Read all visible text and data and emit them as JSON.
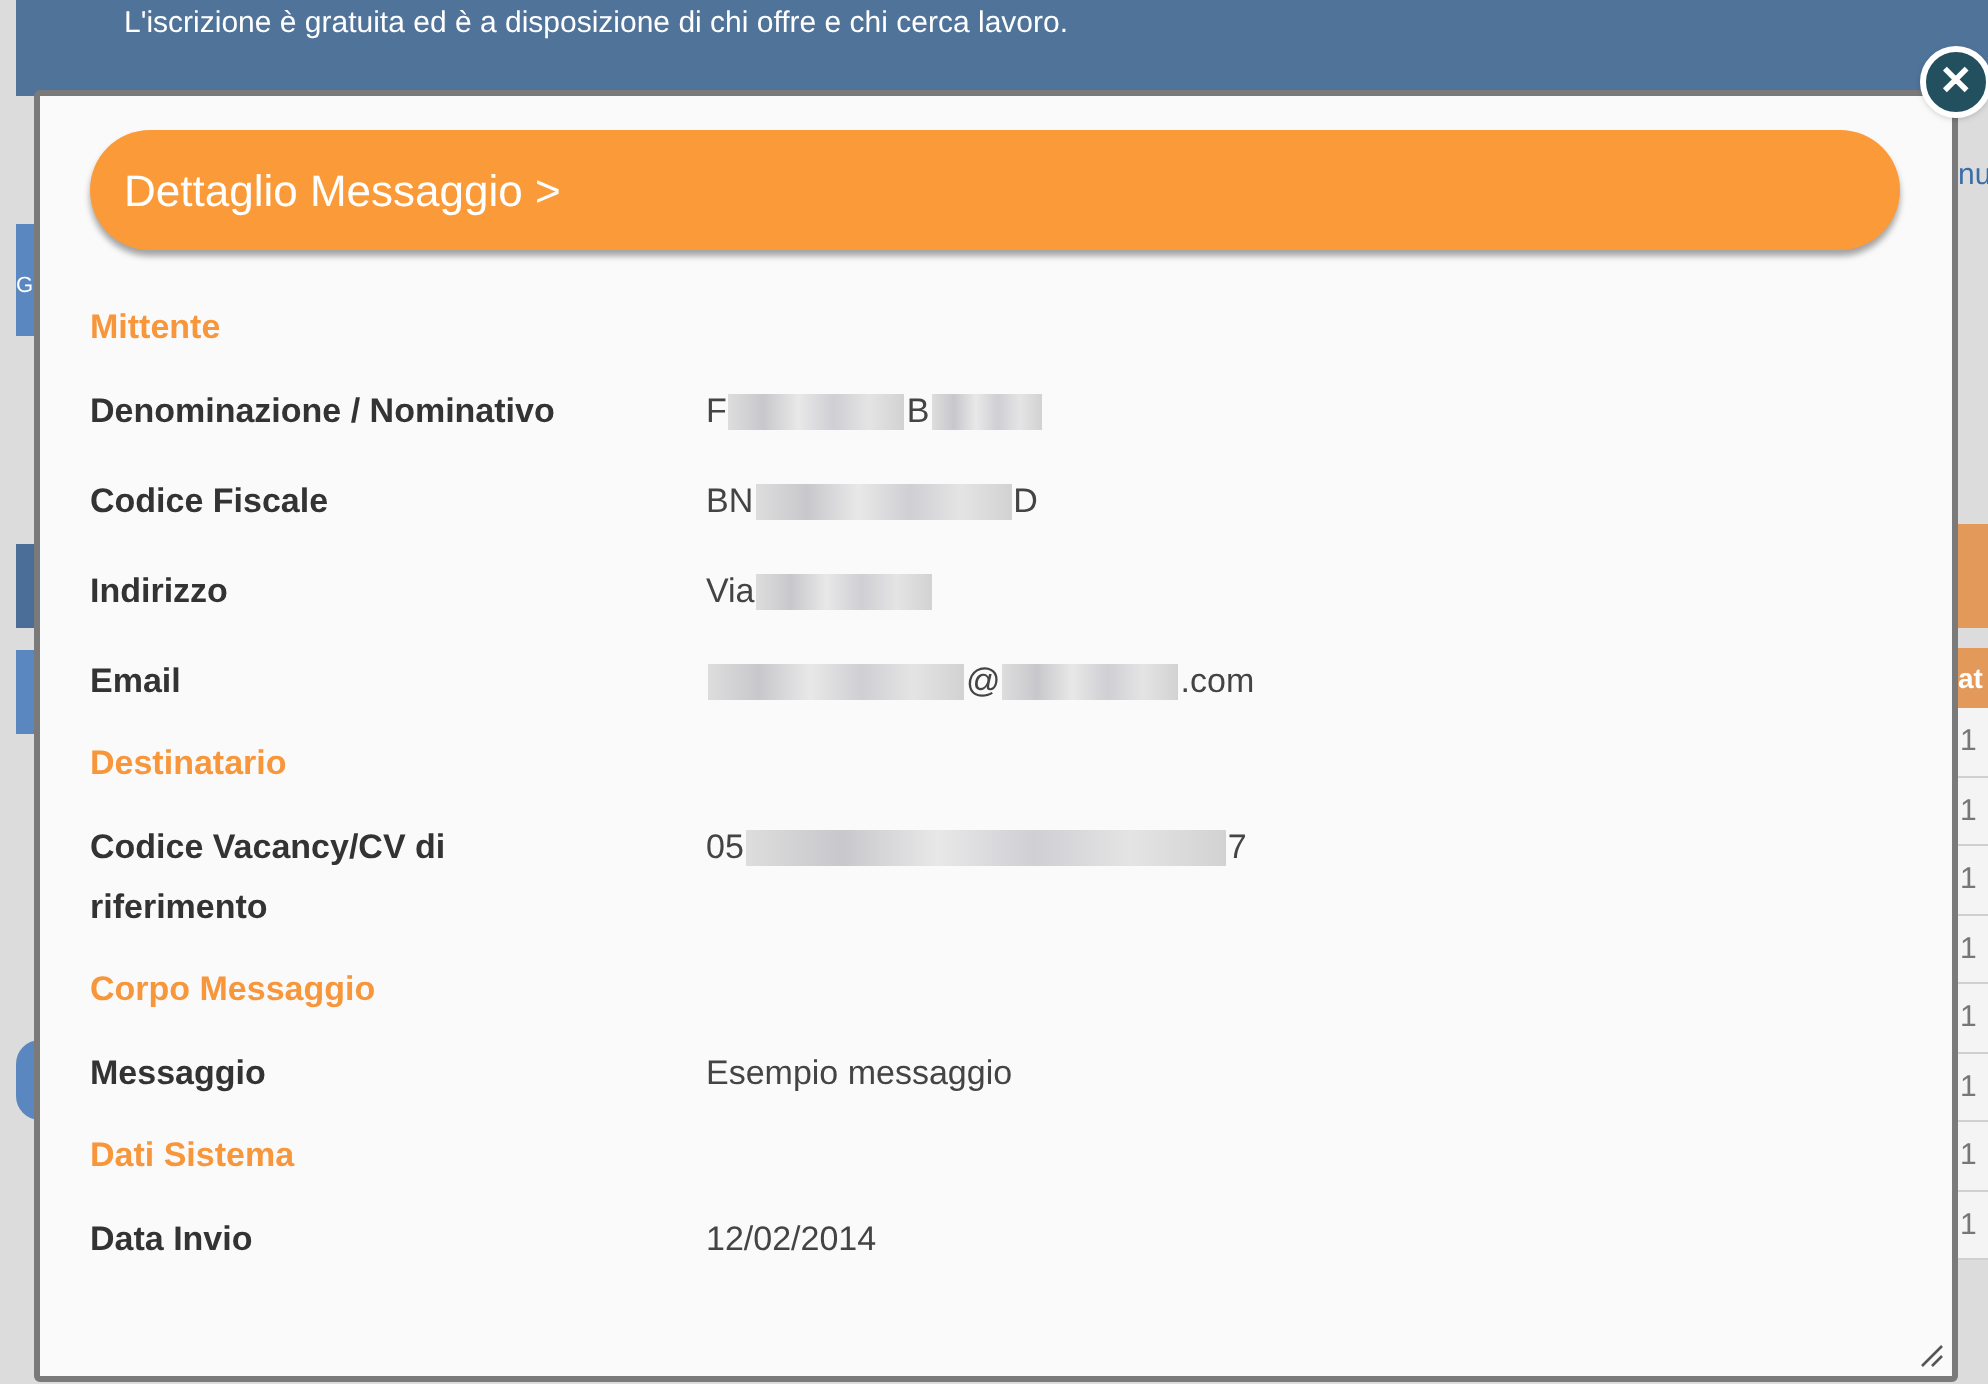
{
  "background": {
    "banner_text": "L'iscrizione è gratuita ed è a disposizione di chi offre e chi cerca lavoro.",
    "left_tab_letter": "G",
    "right_link_text": "nu",
    "right_column_header": "at",
    "right_column_cells": [
      "1",
      "1",
      "1",
      "1",
      "1",
      "1",
      "1",
      "1"
    ]
  },
  "dialog": {
    "title": "Dettaglio Messaggio >",
    "close_label": "✕",
    "sections": [
      {
        "title": "Mittente",
        "rows": [
          {
            "label": "Denominazione / Nominativo",
            "value_parts": [
              {
                "kind": "text",
                "text": "F"
              },
              {
                "kind": "blur_medium"
              },
              {
                "kind": "text",
                "text": "B"
              },
              {
                "kind": "blur_short"
              }
            ]
          },
          {
            "label": "Codice Fiscale",
            "value_parts": [
              {
                "kind": "text",
                "text": "BN"
              },
              {
                "kind": "blur_long"
              },
              {
                "kind": "text",
                "text": "D"
              }
            ]
          },
          {
            "label": "Indirizzo",
            "value_parts": [
              {
                "kind": "text",
                "text": "Via"
              },
              {
                "kind": "blur_medium"
              }
            ]
          },
          {
            "label": "Email",
            "value_parts": [
              {
                "kind": "blur_long"
              },
              {
                "kind": "text",
                "text": "@"
              },
              {
                "kind": "blur_medium"
              },
              {
                "kind": "text",
                "text": ".com"
              }
            ]
          }
        ]
      },
      {
        "title": "Destinatario",
        "rows": [
          {
            "label": "Codice Vacancy/CV di riferimento",
            "value_parts": [
              {
                "kind": "text",
                "text": "05"
              },
              {
                "kind": "blur_xlong"
              },
              {
                "kind": "text",
                "text": "7"
              }
            ]
          }
        ]
      },
      {
        "title": "Corpo Messaggio",
        "rows": [
          {
            "label": "Messaggio",
            "value_parts": [
              {
                "kind": "text",
                "text": "Esempio messaggio"
              }
            ]
          }
        ]
      },
      {
        "title": "Dati Sistema",
        "rows": [
          {
            "label": "Data Invio",
            "value_parts": [
              {
                "kind": "text",
                "text": "12/02/2014"
              }
            ]
          }
        ]
      }
    ]
  }
}
